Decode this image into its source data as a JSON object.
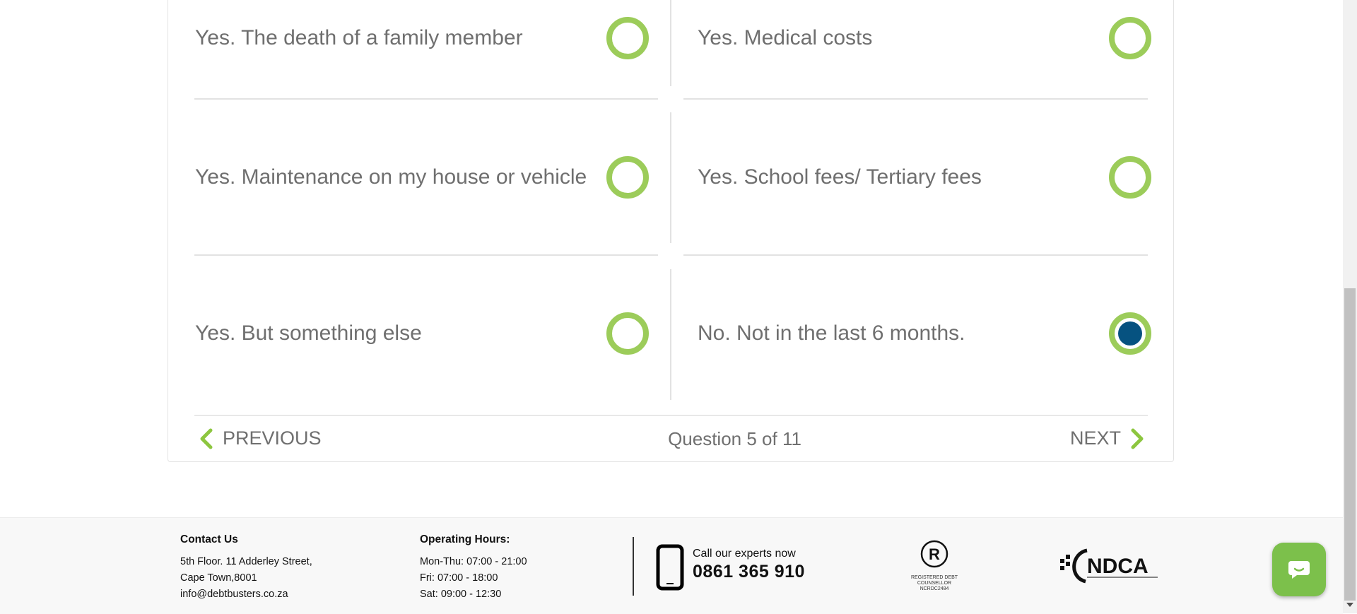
{
  "question": {
    "options": [
      {
        "label": "Yes. The death of a family member",
        "selected": false
      },
      {
        "label": "Yes. Medical costs",
        "selected": false
      },
      {
        "label": "Yes. Maintenance on my house or vehicle",
        "selected": false
      },
      {
        "label": "Yes. School fees/ Tertiary fees",
        "selected": false
      },
      {
        "label": "Yes. But something else",
        "selected": false
      },
      {
        "label": "No. Not in the last 6 months.",
        "selected": true
      }
    ],
    "previous_label": "PREVIOUS",
    "next_label": "NEXT",
    "progress": "Question 5 of 11"
  },
  "footer": {
    "contact": {
      "heading": "Contact Us",
      "line1": "5th Floor. 11 Adderley Street,",
      "line2": "Cape Town,8001",
      "email": "info@debtbusters.co.za"
    },
    "hours": {
      "heading": "Operating Hours:",
      "line1": "Mon-Thu: 07:00 - 21:00",
      "line2": "Fri: 07:00 - 18:00",
      "line3": "Sat: 09:00 - 12:30"
    },
    "call": {
      "prompt": "Call our experts now",
      "number": "0861 365 910"
    },
    "registered": {
      "mark": "R",
      "line1": "REGISTERED DEBT",
      "line2": "COUNSELLOR",
      "line3": "NCRDC2484"
    },
    "ndca_logo": "NDCA"
  },
  "colors": {
    "radio_ring": "#9ccc5a",
    "radio_selected": "#065280",
    "chat_button": "#7cc04b"
  }
}
